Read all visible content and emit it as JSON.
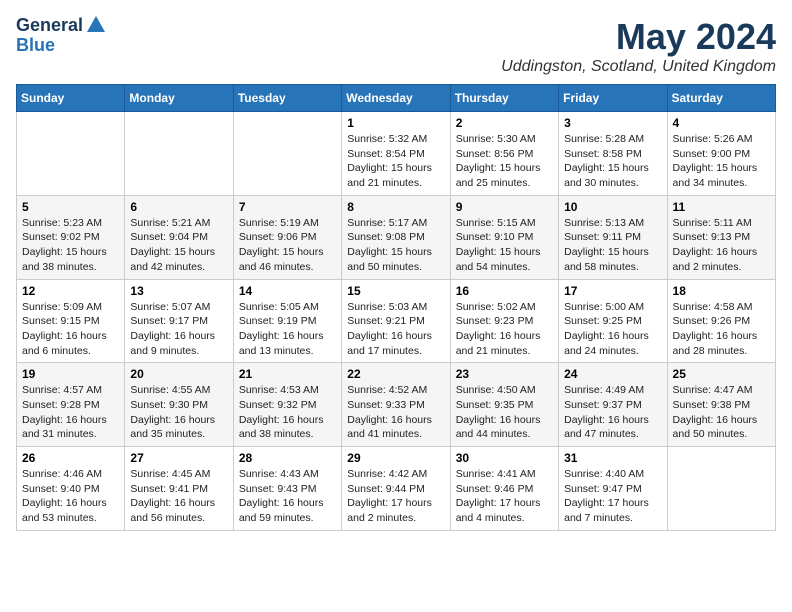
{
  "logo": {
    "line1": "General",
    "line2": "Blue"
  },
  "title": "May 2024",
  "location": "Uddingston, Scotland, United Kingdom",
  "days_header": [
    "Sunday",
    "Monday",
    "Tuesday",
    "Wednesday",
    "Thursday",
    "Friday",
    "Saturday"
  ],
  "weeks": [
    [
      {
        "day": "",
        "info": ""
      },
      {
        "day": "",
        "info": ""
      },
      {
        "day": "",
        "info": ""
      },
      {
        "day": "1",
        "info": "Sunrise: 5:32 AM\nSunset: 8:54 PM\nDaylight: 15 hours\nand 21 minutes."
      },
      {
        "day": "2",
        "info": "Sunrise: 5:30 AM\nSunset: 8:56 PM\nDaylight: 15 hours\nand 25 minutes."
      },
      {
        "day": "3",
        "info": "Sunrise: 5:28 AM\nSunset: 8:58 PM\nDaylight: 15 hours\nand 30 minutes."
      },
      {
        "day": "4",
        "info": "Sunrise: 5:26 AM\nSunset: 9:00 PM\nDaylight: 15 hours\nand 34 minutes."
      }
    ],
    [
      {
        "day": "5",
        "info": "Sunrise: 5:23 AM\nSunset: 9:02 PM\nDaylight: 15 hours\nand 38 minutes."
      },
      {
        "day": "6",
        "info": "Sunrise: 5:21 AM\nSunset: 9:04 PM\nDaylight: 15 hours\nand 42 minutes."
      },
      {
        "day": "7",
        "info": "Sunrise: 5:19 AM\nSunset: 9:06 PM\nDaylight: 15 hours\nand 46 minutes."
      },
      {
        "day": "8",
        "info": "Sunrise: 5:17 AM\nSunset: 9:08 PM\nDaylight: 15 hours\nand 50 minutes."
      },
      {
        "day": "9",
        "info": "Sunrise: 5:15 AM\nSunset: 9:10 PM\nDaylight: 15 hours\nand 54 minutes."
      },
      {
        "day": "10",
        "info": "Sunrise: 5:13 AM\nSunset: 9:11 PM\nDaylight: 15 hours\nand 58 minutes."
      },
      {
        "day": "11",
        "info": "Sunrise: 5:11 AM\nSunset: 9:13 PM\nDaylight: 16 hours\nand 2 minutes."
      }
    ],
    [
      {
        "day": "12",
        "info": "Sunrise: 5:09 AM\nSunset: 9:15 PM\nDaylight: 16 hours\nand 6 minutes."
      },
      {
        "day": "13",
        "info": "Sunrise: 5:07 AM\nSunset: 9:17 PM\nDaylight: 16 hours\nand 9 minutes."
      },
      {
        "day": "14",
        "info": "Sunrise: 5:05 AM\nSunset: 9:19 PM\nDaylight: 16 hours\nand 13 minutes."
      },
      {
        "day": "15",
        "info": "Sunrise: 5:03 AM\nSunset: 9:21 PM\nDaylight: 16 hours\nand 17 minutes."
      },
      {
        "day": "16",
        "info": "Sunrise: 5:02 AM\nSunset: 9:23 PM\nDaylight: 16 hours\nand 21 minutes."
      },
      {
        "day": "17",
        "info": "Sunrise: 5:00 AM\nSunset: 9:25 PM\nDaylight: 16 hours\nand 24 minutes."
      },
      {
        "day": "18",
        "info": "Sunrise: 4:58 AM\nSunset: 9:26 PM\nDaylight: 16 hours\nand 28 minutes."
      }
    ],
    [
      {
        "day": "19",
        "info": "Sunrise: 4:57 AM\nSunset: 9:28 PM\nDaylight: 16 hours\nand 31 minutes."
      },
      {
        "day": "20",
        "info": "Sunrise: 4:55 AM\nSunset: 9:30 PM\nDaylight: 16 hours\nand 35 minutes."
      },
      {
        "day": "21",
        "info": "Sunrise: 4:53 AM\nSunset: 9:32 PM\nDaylight: 16 hours\nand 38 minutes."
      },
      {
        "day": "22",
        "info": "Sunrise: 4:52 AM\nSunset: 9:33 PM\nDaylight: 16 hours\nand 41 minutes."
      },
      {
        "day": "23",
        "info": "Sunrise: 4:50 AM\nSunset: 9:35 PM\nDaylight: 16 hours\nand 44 minutes."
      },
      {
        "day": "24",
        "info": "Sunrise: 4:49 AM\nSunset: 9:37 PM\nDaylight: 16 hours\nand 47 minutes."
      },
      {
        "day": "25",
        "info": "Sunrise: 4:47 AM\nSunset: 9:38 PM\nDaylight: 16 hours\nand 50 minutes."
      }
    ],
    [
      {
        "day": "26",
        "info": "Sunrise: 4:46 AM\nSunset: 9:40 PM\nDaylight: 16 hours\nand 53 minutes."
      },
      {
        "day": "27",
        "info": "Sunrise: 4:45 AM\nSunset: 9:41 PM\nDaylight: 16 hours\nand 56 minutes."
      },
      {
        "day": "28",
        "info": "Sunrise: 4:43 AM\nSunset: 9:43 PM\nDaylight: 16 hours\nand 59 minutes."
      },
      {
        "day": "29",
        "info": "Sunrise: 4:42 AM\nSunset: 9:44 PM\nDaylight: 17 hours\nand 2 minutes."
      },
      {
        "day": "30",
        "info": "Sunrise: 4:41 AM\nSunset: 9:46 PM\nDaylight: 17 hours\nand 4 minutes."
      },
      {
        "day": "31",
        "info": "Sunrise: 4:40 AM\nSunset: 9:47 PM\nDaylight: 17 hours\nand 7 minutes."
      },
      {
        "day": "",
        "info": ""
      }
    ]
  ]
}
